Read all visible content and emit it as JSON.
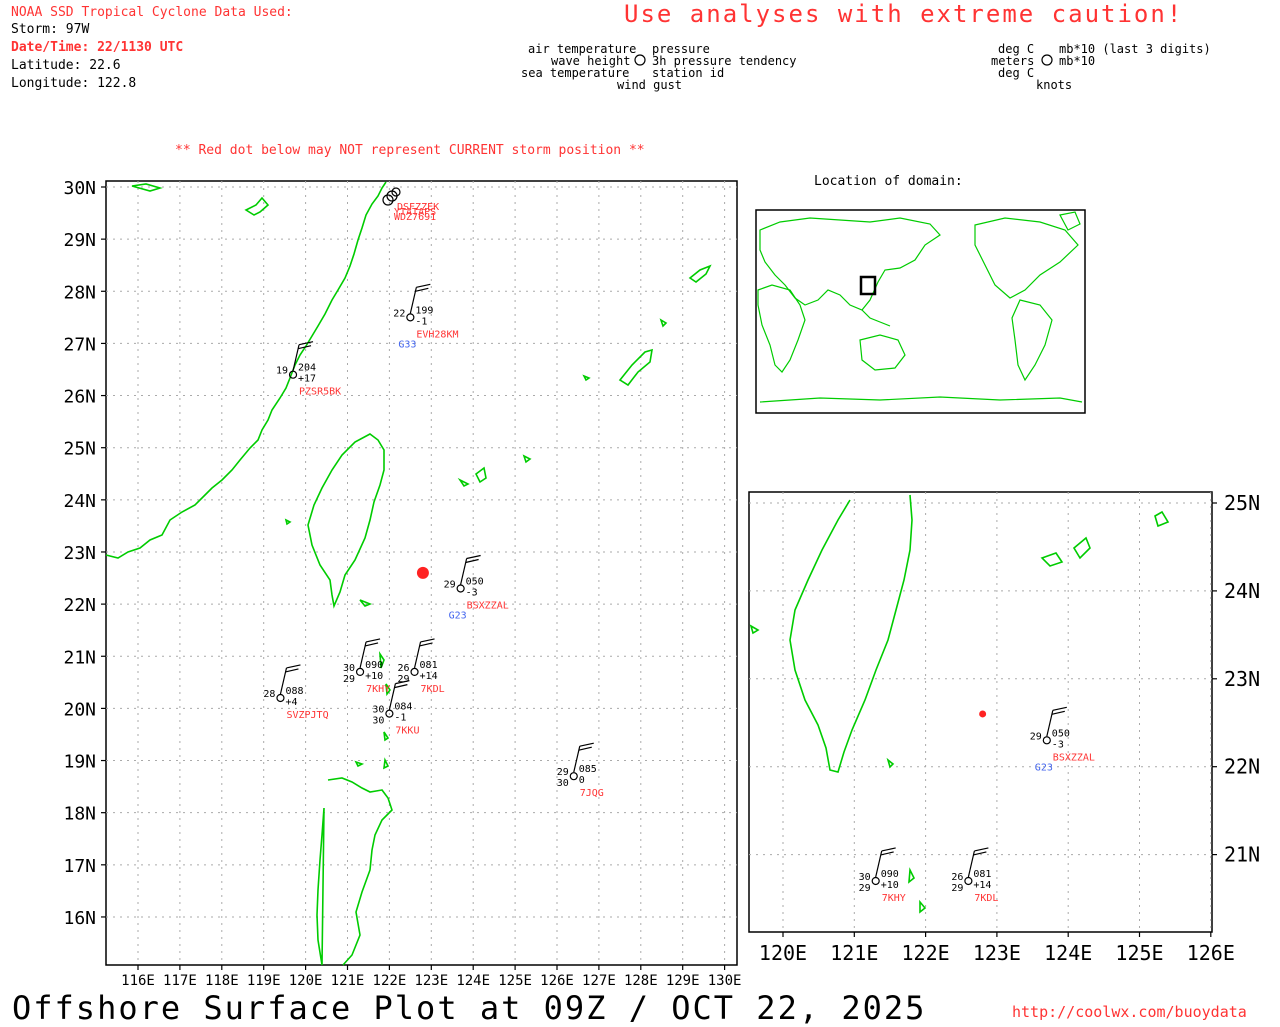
{
  "header": {
    "source_title": "NOAA SSD Tropical Cyclone Data Used:",
    "storm": "Storm: 97W",
    "datetime": "Date/Time: 22/1130 UTC",
    "latitude": "Latitude: 22.6",
    "longitude": "Longitude: 122.8",
    "caution": "Use analyses with extreme caution!",
    "red_dot_note": "** Red dot below may NOT represent CURRENT storm position **"
  },
  "legend_left": {
    "air_temperature": "air temperature",
    "wave_height": "wave height",
    "sea_temperature": "sea temperature",
    "wind_gust": "wind gust",
    "pressure": "pressure",
    "pressure_tendency": "3h pressure tendency",
    "station_id": "station id"
  },
  "legend_right": {
    "deg_c_top": "deg C",
    "meters": "meters",
    "deg_c_bottom": "deg C",
    "mb_last3": "mb*10 (last 3 digits)",
    "mb10": "mb*10",
    "knots": "knots"
  },
  "inset_title": "Location of domain:",
  "footer": {
    "plot_title": "Offshore Surface Plot at 09Z / OCT 22, 2025",
    "url": "http://coolwx.com/buoydata"
  },
  "colors": {
    "coast": "#00cc00",
    "station_id": "#ff3333",
    "gust": "#4466ee",
    "storm_dot": "#ff2222",
    "grid": "#aaaaaa"
  },
  "main_map": {
    "lat_labels": [
      "30N",
      "29N",
      "28N",
      "27N",
      "26N",
      "25N",
      "24N",
      "23N",
      "22N",
      "21N",
      "20N",
      "19N",
      "18N",
      "17N",
      "16N"
    ],
    "lon_labels": [
      "116E",
      "117E",
      "118E",
      "119E",
      "120E",
      "121E",
      "122E",
      "123E",
      "124E",
      "125E",
      "126E",
      "127E",
      "128E",
      "129E",
      "130E"
    ],
    "storm_position": {
      "lat": 22.6,
      "lon": 122.8
    },
    "stations": [
      {
        "id": "EVH28KM",
        "air": "22",
        "pres": "199",
        "tend": "-1",
        "gust": "G33",
        "lat": 27.5,
        "lon": 122.5
      },
      {
        "id": "PZSR5BK",
        "air": "19",
        "pres": "204",
        "tend": "+17",
        "lat": 26.4,
        "lon": 119.7
      },
      {
        "id": "BSXZZAL",
        "air": "29",
        "pres": "050",
        "tend": "-3",
        "gust": "G23",
        "lat": 22.3,
        "lon": 123.7
      },
      {
        "id": "7KHY",
        "air": "30",
        "sea": "29",
        "pres": "090",
        "tend": "+10",
        "lat": 20.7,
        "lon": 121.3
      },
      {
        "id": "7KDL",
        "air": "26",
        "sea": "29",
        "pres": "081",
        "tend": "+14",
        "lat": 20.7,
        "lon": 122.6
      },
      {
        "id": "SVZPJTQ",
        "air": "28",
        "pres": "088",
        "tend": "+4",
        "lat": 20.2,
        "lon": 119.4
      },
      {
        "id": "7KKU",
        "air": "30",
        "sea": "30",
        "pres": "084",
        "tend": "-1",
        "lat": 19.9,
        "lon": 122.0
      },
      {
        "id": "7JQG",
        "air": "29",
        "sea": "30",
        "pres": "085",
        "tend": "0",
        "lat": 18.7,
        "lon": 126.4
      }
    ],
    "cluster_ids": [
      "DSFZZEK",
      "YTATAPS",
      "WDZ7691"
    ]
  },
  "zoom_map": {
    "lat_labels": [
      "25N",
      "24N",
      "23N",
      "22N",
      "21N"
    ],
    "lon_labels": [
      "120E",
      "121E",
      "122E",
      "123E",
      "124E",
      "125E",
      "126E"
    ],
    "storm_position": {
      "lat": 22.6,
      "lon": 122.8
    },
    "stations": [
      {
        "id": "BSXZZAL",
        "air": "29",
        "pres": "050",
        "tend": "-3",
        "gust": "G23",
        "lat": 22.3,
        "lon": 123.7
      },
      {
        "id": "7KHY",
        "air": "30",
        "sea": "29",
        "pres": "090",
        "tend": "+10",
        "lat": 20.7,
        "lon": 121.3
      },
      {
        "id": "7KDL",
        "air": "26",
        "sea": "29",
        "pres": "081",
        "tend": "+14",
        "lat": 20.7,
        "lon": 122.6
      }
    ]
  }
}
